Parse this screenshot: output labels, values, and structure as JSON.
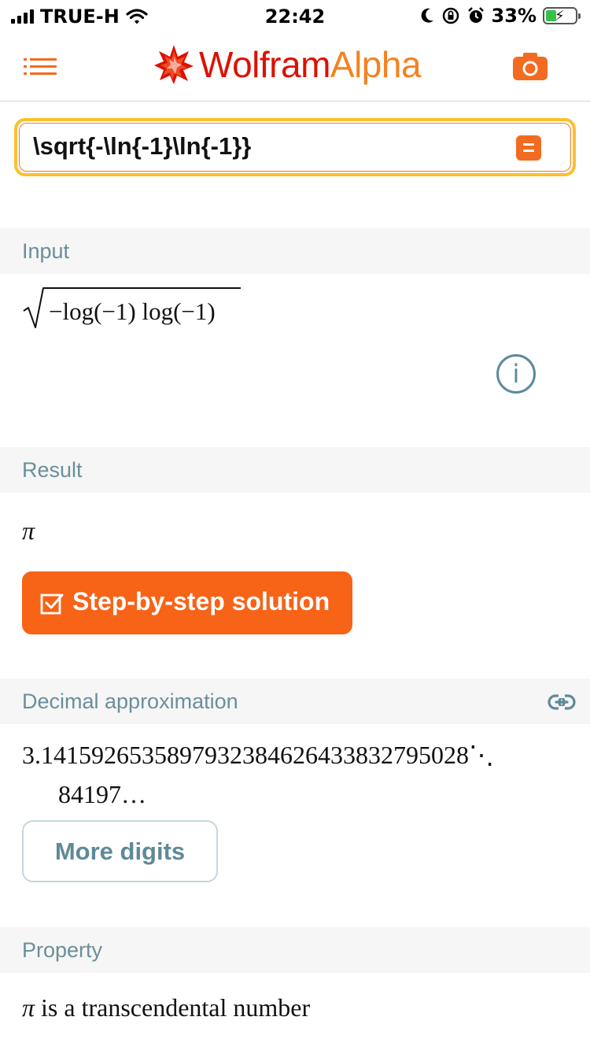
{
  "status_bar": {
    "carrier": "TRUE-H",
    "time": "22:42",
    "battery": "33%"
  },
  "header": {
    "brand_part1": "Wolfram",
    "brand_part2": "Alpha"
  },
  "search": {
    "value": "\\sqrt{-\\ln{-1}\\ln{-1}}"
  },
  "pods": {
    "input": {
      "title": "Input",
      "expression": "−log(−1) log(−1)"
    },
    "result": {
      "title": "Result",
      "value": "π",
      "step_button": "Step-by-step solution"
    },
    "decimal": {
      "title": "Decimal approximation",
      "line1": "3.1415926535897932384626433832795028⋱",
      "line2": "84197…",
      "more_button": "More digits"
    },
    "property": {
      "title": "Property",
      "symbol": "π",
      "text": " is a transcendental number"
    }
  },
  "icons": {
    "menu": "menu-icon",
    "logo": "wolfram-star-icon",
    "camera": "camera-icon",
    "equals": "equals-icon",
    "info": "info-icon",
    "checkbox": "checkbox-icon",
    "link": "link-icon"
  },
  "colors": {
    "brand_red": "#dd1100",
    "brand_orange": "#f5821f",
    "accent": "#f76317",
    "pod_title": "#6b8e9b",
    "search_border": "#fbc02d"
  }
}
